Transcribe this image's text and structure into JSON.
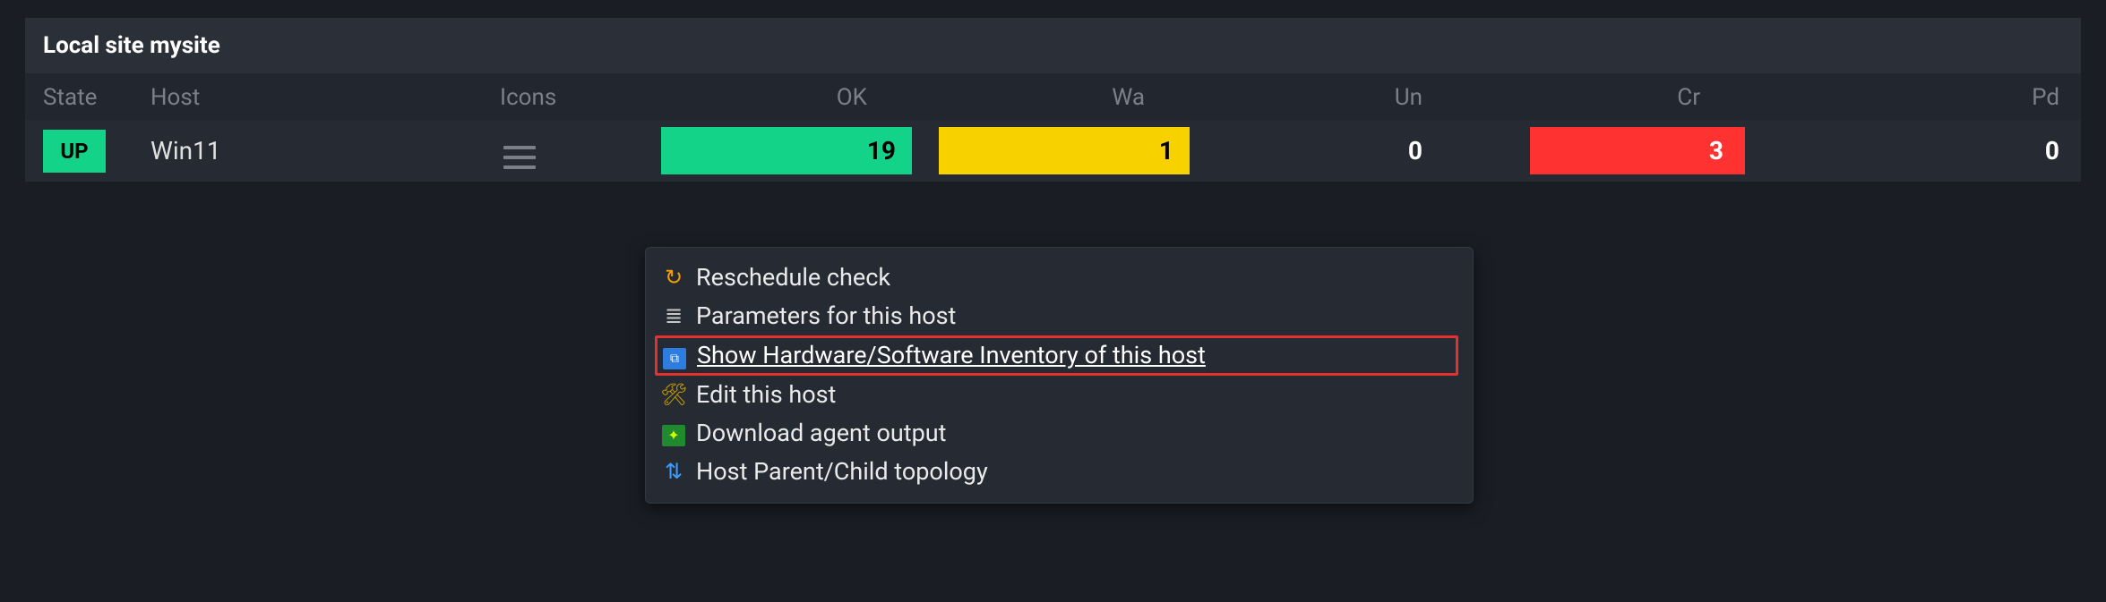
{
  "panel": {
    "title": "Local site mysite"
  },
  "columns": {
    "state": "State",
    "host": "Host",
    "icons": "Icons",
    "ok": "OK",
    "wa": "Wa",
    "un": "Un",
    "cr": "Cr",
    "pd": "Pd"
  },
  "row": {
    "state": "UP",
    "host": "Win11",
    "ok": "19",
    "wa": "1",
    "un": "0",
    "cr": "3",
    "pd": "0"
  },
  "menu": {
    "reschedule": "Reschedule check",
    "parameters": "Parameters for this host",
    "inventory": "Show Hardware/Software Inventory of this host",
    "edit": "Edit this host",
    "download": "Download agent output",
    "topology": "Host Parent/Child topology"
  },
  "colors": {
    "up": "#13d389",
    "warn": "#f7d100",
    "crit": "#ff3232"
  }
}
